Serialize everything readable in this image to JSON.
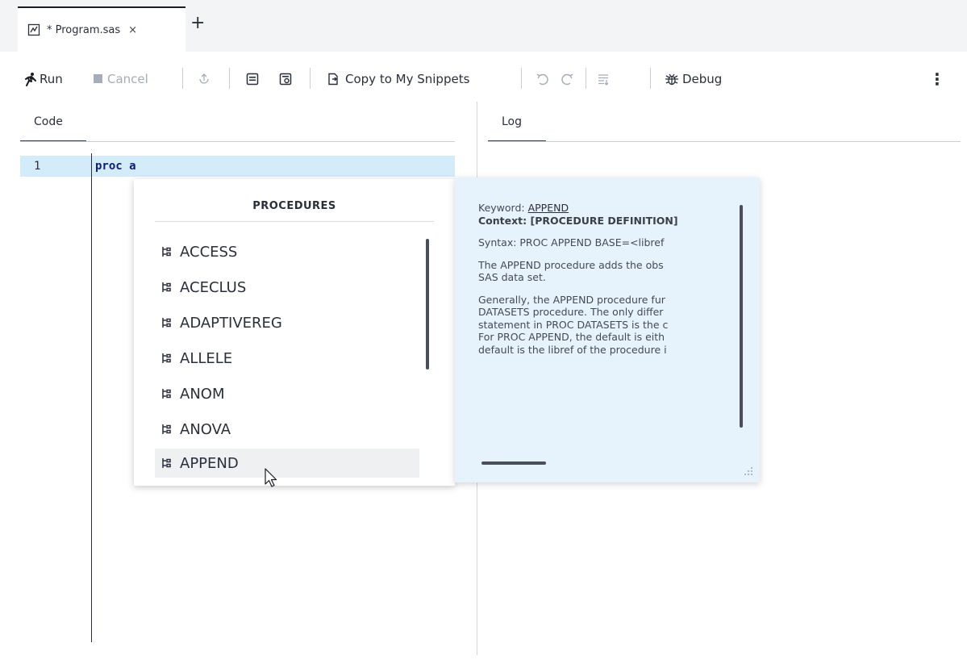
{
  "tab": {
    "label": "* Program.sas",
    "close": "×",
    "add": "+"
  },
  "toolbar": {
    "run": "Run",
    "cancel": "Cancel",
    "copy_snippets": "Copy to My Snippets",
    "debug": "Debug",
    "more": "⋮"
  },
  "panes": {
    "code_tab": "Code",
    "log_tab": "Log"
  },
  "editor": {
    "line_number": "1",
    "code": "proc a"
  },
  "autocomplete": {
    "title": "PROCEDURES",
    "items": [
      {
        "label": "ACCESS"
      },
      {
        "label": "ACECLUS"
      },
      {
        "label": "ADAPTIVEREG"
      },
      {
        "label": "ALLELE"
      },
      {
        "label": "ANOM"
      },
      {
        "label": "ANOVA"
      },
      {
        "label": "APPEND"
      }
    ],
    "selected": "APPEND"
  },
  "info_panel": {
    "keyword_label": "Keyword:",
    "keyword": "APPEND",
    "context": "Context: [PROCEDURE DEFINITION]",
    "syntax": "Syntax: PROC APPEND BASE=<libref",
    "desc_line1": "The APPEND procedure adds the obs",
    "desc_line2": "SAS data set.",
    "gen_line1": "Generally, the APPEND procedure fur",
    "gen_line2": "DATASETS procedure. The only differ",
    "gen_line3": "statement in PROC DATASETS is the c",
    "gen_line4": "For PROC APPEND, the default is eith",
    "gen_line5": "default is the libref of the procedure i"
  },
  "colors": {
    "code_keyword": "#0b1f7a",
    "line_highlight": "#d4ebfa",
    "info_background": "#e6f2fc",
    "tabbar_background": "#f3f4f6",
    "disabled": "#a6acb8"
  },
  "icons": [
    "program-file-icon",
    "run-icon",
    "stop-icon",
    "submit-icon",
    "clear-icon",
    "save-log-icon",
    "copy-snippet-icon",
    "undo-icon",
    "redo-icon",
    "format-code-icon",
    "bug-icon",
    "more-icon",
    "procedure-icon",
    "resize-grip-icon",
    "mouse-pointer-icon"
  ]
}
